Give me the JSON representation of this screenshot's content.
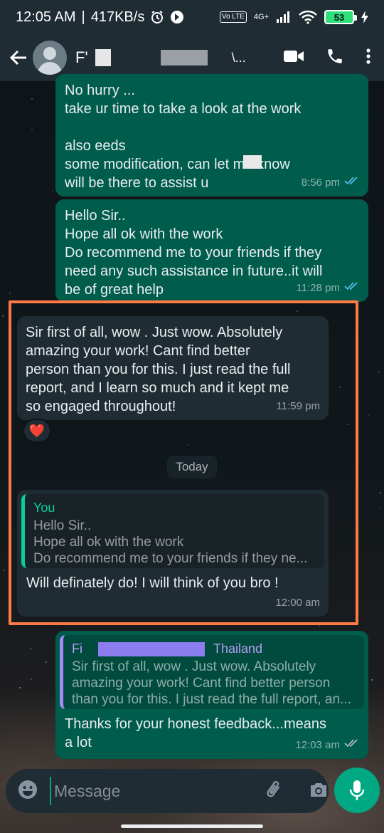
{
  "status_bar": {
    "time": "12:05 AM",
    "separator": "|",
    "speed": "417KB/s",
    "network_label": "Vo LTE",
    "network_gen": "4G+",
    "battery": "53"
  },
  "header": {
    "contact_name_initial": "F'",
    "contact_name_suffix": "\\..."
  },
  "messages": [
    {
      "direction": "outgoing",
      "lines": "No hurry ...\ntake ur time to take a look at the work\n\nalso                                        eeds\nsome modification, can let me know\nwill be there to assist u",
      "time": "8:56 pm",
      "status": "read"
    },
    {
      "direction": "outgoing",
      "lines": "Hello Sir..\nHope all ok with the work\nDo recommend me to your friends if they\nneed any such assistance in future..it will\nbe of great help",
      "time": "11:28 pm",
      "status": "read"
    },
    {
      "direction": "incoming",
      "lines": "Sir first of all, wow . Just wow. Absolutely\namazing your work! Cant find better\nperson than you for this. I just read the full\nreport, and I learn so much and it kept me\nso engaged throughout!",
      "time": "11:59 pm",
      "reaction": "❤️"
    },
    {
      "direction": "incoming",
      "quote_name": "You",
      "quote_text": "Hello Sir..\nHope all ok with the work\nDo recommend me to your friends if they ne...",
      "lines": "Will definately do! I will think of you bro !",
      "time": "12:00 am"
    },
    {
      "direction": "outgoing",
      "quote_name_prefix": "Fi",
      "quote_name_suffix": "Thailand",
      "quote_text": "Sir first of all, wow . Just wow. Absolutely\namazing your work! Cant find better person\nthan you for this. I just read the full report, an...",
      "lines": "Thanks for your honest feedback...means\na lot",
      "time": "12:03 am",
      "status": "delivered"
    }
  ],
  "date_chip": "Today",
  "composer": {
    "placeholder": "Message"
  },
  "icons": {
    "back": "arrow-left-icon",
    "video": "video-call-icon",
    "call": "phone-icon",
    "menu": "more-vert-icon",
    "emoji": "emoji-icon",
    "attach": "paperclip-icon",
    "camera": "camera-icon",
    "mic": "mic-icon"
  },
  "colors": {
    "outgoing_bubble": "#005c4b",
    "incoming_bubble": "#202c33",
    "accent": "#00a884",
    "read_ticks": "#53bdeb",
    "highlight_box": "#ff7a45"
  }
}
